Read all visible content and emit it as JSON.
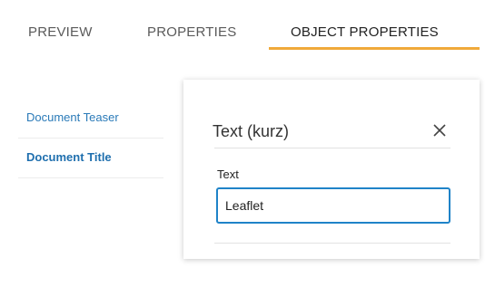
{
  "tabs": {
    "preview": "PREVIEW",
    "properties": "PROPERTIES",
    "object_properties": "OBJECT PROPERTIES",
    "active": "object_properties",
    "active_color": "#f0a93a"
  },
  "sidebar": {
    "items": [
      {
        "label": "Document Teaser",
        "active": false
      },
      {
        "label": "Document Title",
        "active": true
      }
    ],
    "link_color": "#2a7ab8"
  },
  "panel": {
    "title": "Text (kurz)",
    "close_icon": "close-icon",
    "field": {
      "label": "Text",
      "value": "Leaflet",
      "border_color": "#1f83c8"
    }
  }
}
